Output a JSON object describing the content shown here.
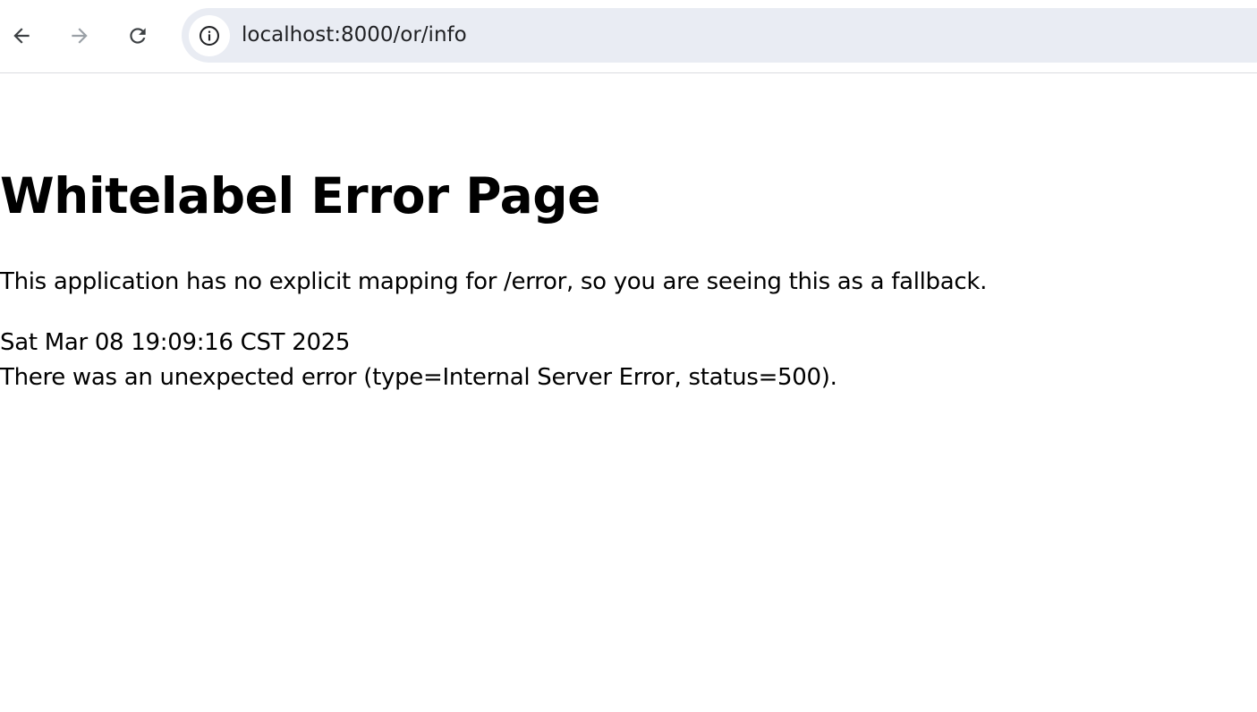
{
  "browser": {
    "url": "localhost:8000/or/info",
    "icons": {
      "back": "arrow-left-icon",
      "forward": "arrow-right-icon",
      "reload": "reload-icon",
      "site_info": "info-icon"
    },
    "colors": {
      "omnibox_bg": "#e9ecf3",
      "forward_disabled": "#9aa0a6"
    }
  },
  "page": {
    "heading": "Whitelabel Error Page",
    "message": "This application has no explicit mapping for /error, so you are seeing this as a fallback.",
    "timestamp": "Sat Mar 08 19:09:16 CST 2025",
    "error": "There was an unexpected error (type=Internal Server Error, status=500)."
  }
}
